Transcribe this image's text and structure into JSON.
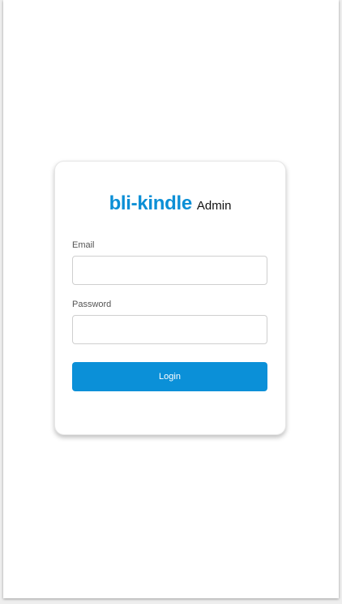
{
  "brand": {
    "name": "bli-kindle",
    "suffix": "Admin"
  },
  "form": {
    "email_label": "Email",
    "email_value": "",
    "email_placeholder": "",
    "password_label": "Password",
    "password_value": "",
    "password_placeholder": "",
    "login_label": "Login"
  },
  "colors": {
    "brand": "#0b8fd6",
    "button": "#0b90d8",
    "button_text": "#ffffff"
  }
}
